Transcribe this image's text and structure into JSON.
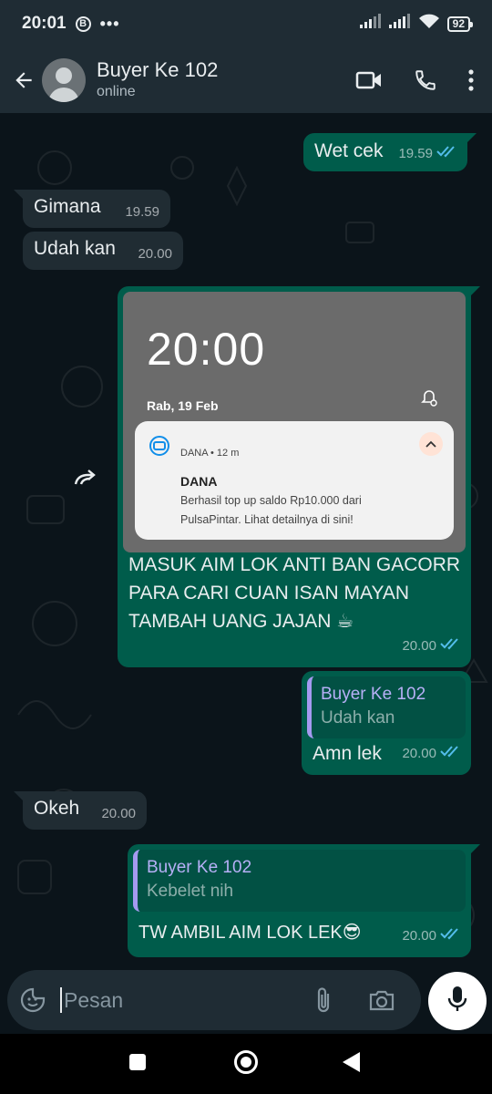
{
  "status_bar": {
    "time": "20:01",
    "badge": "B",
    "more": "•••",
    "battery": "92"
  },
  "header": {
    "contact_name": "Buyer Ke 102",
    "contact_status": "online"
  },
  "messages": [
    {
      "text": "Wet cek",
      "time": "19.59"
    },
    {
      "text": "Gimana",
      "time": "19.59"
    },
    {
      "text": "Udah kan",
      "time": "20.00"
    },
    {
      "image": {
        "lock_time": "20:00",
        "lock_date": "Rab, 19 Feb",
        "notification": {
          "app": "DANA • 12 m",
          "title": "DANA",
          "body": "Berhasil top up saldo Rp10.000 dari PulsaPintar. Lihat detailnya di sini!"
        }
      },
      "caption_lines": [
        "MASUK AIM LOK ANTI BAN GACORR",
        "PARA CARI CUAN ISAN MAYAN",
        "TAMBAH UANG JAJAN ☕"
      ],
      "time": "20.00"
    },
    {
      "quote_author": "Buyer Ke 102",
      "quote_text": "Udah kan",
      "text": "Amn lek",
      "time": "20.00"
    },
    {
      "text": "Okeh",
      "time": "20.00"
    },
    {
      "quote_author": "Buyer Ke 102",
      "quote_text": "Kebelet nih",
      "text": "TW AMBIL AIM LOK LEK😎",
      "time": "20.00"
    }
  ],
  "composer": {
    "placeholder": "Pesan"
  },
  "colors": {
    "header_bg": "#1f2c34",
    "chat_bg": "#0b141a",
    "outgoing_bubble": "#005c4b",
    "incoming_bubble": "#202c33",
    "read_ticks": "#53bdeb",
    "quote_bar": "#a59af0"
  },
  "icons": [
    "back-arrow-icon",
    "video-call-icon",
    "voice-call-icon",
    "more-vert-icon",
    "double-check-icon",
    "forward-icon",
    "sticker-icon",
    "attach-icon",
    "camera-icon",
    "mic-icon"
  ]
}
